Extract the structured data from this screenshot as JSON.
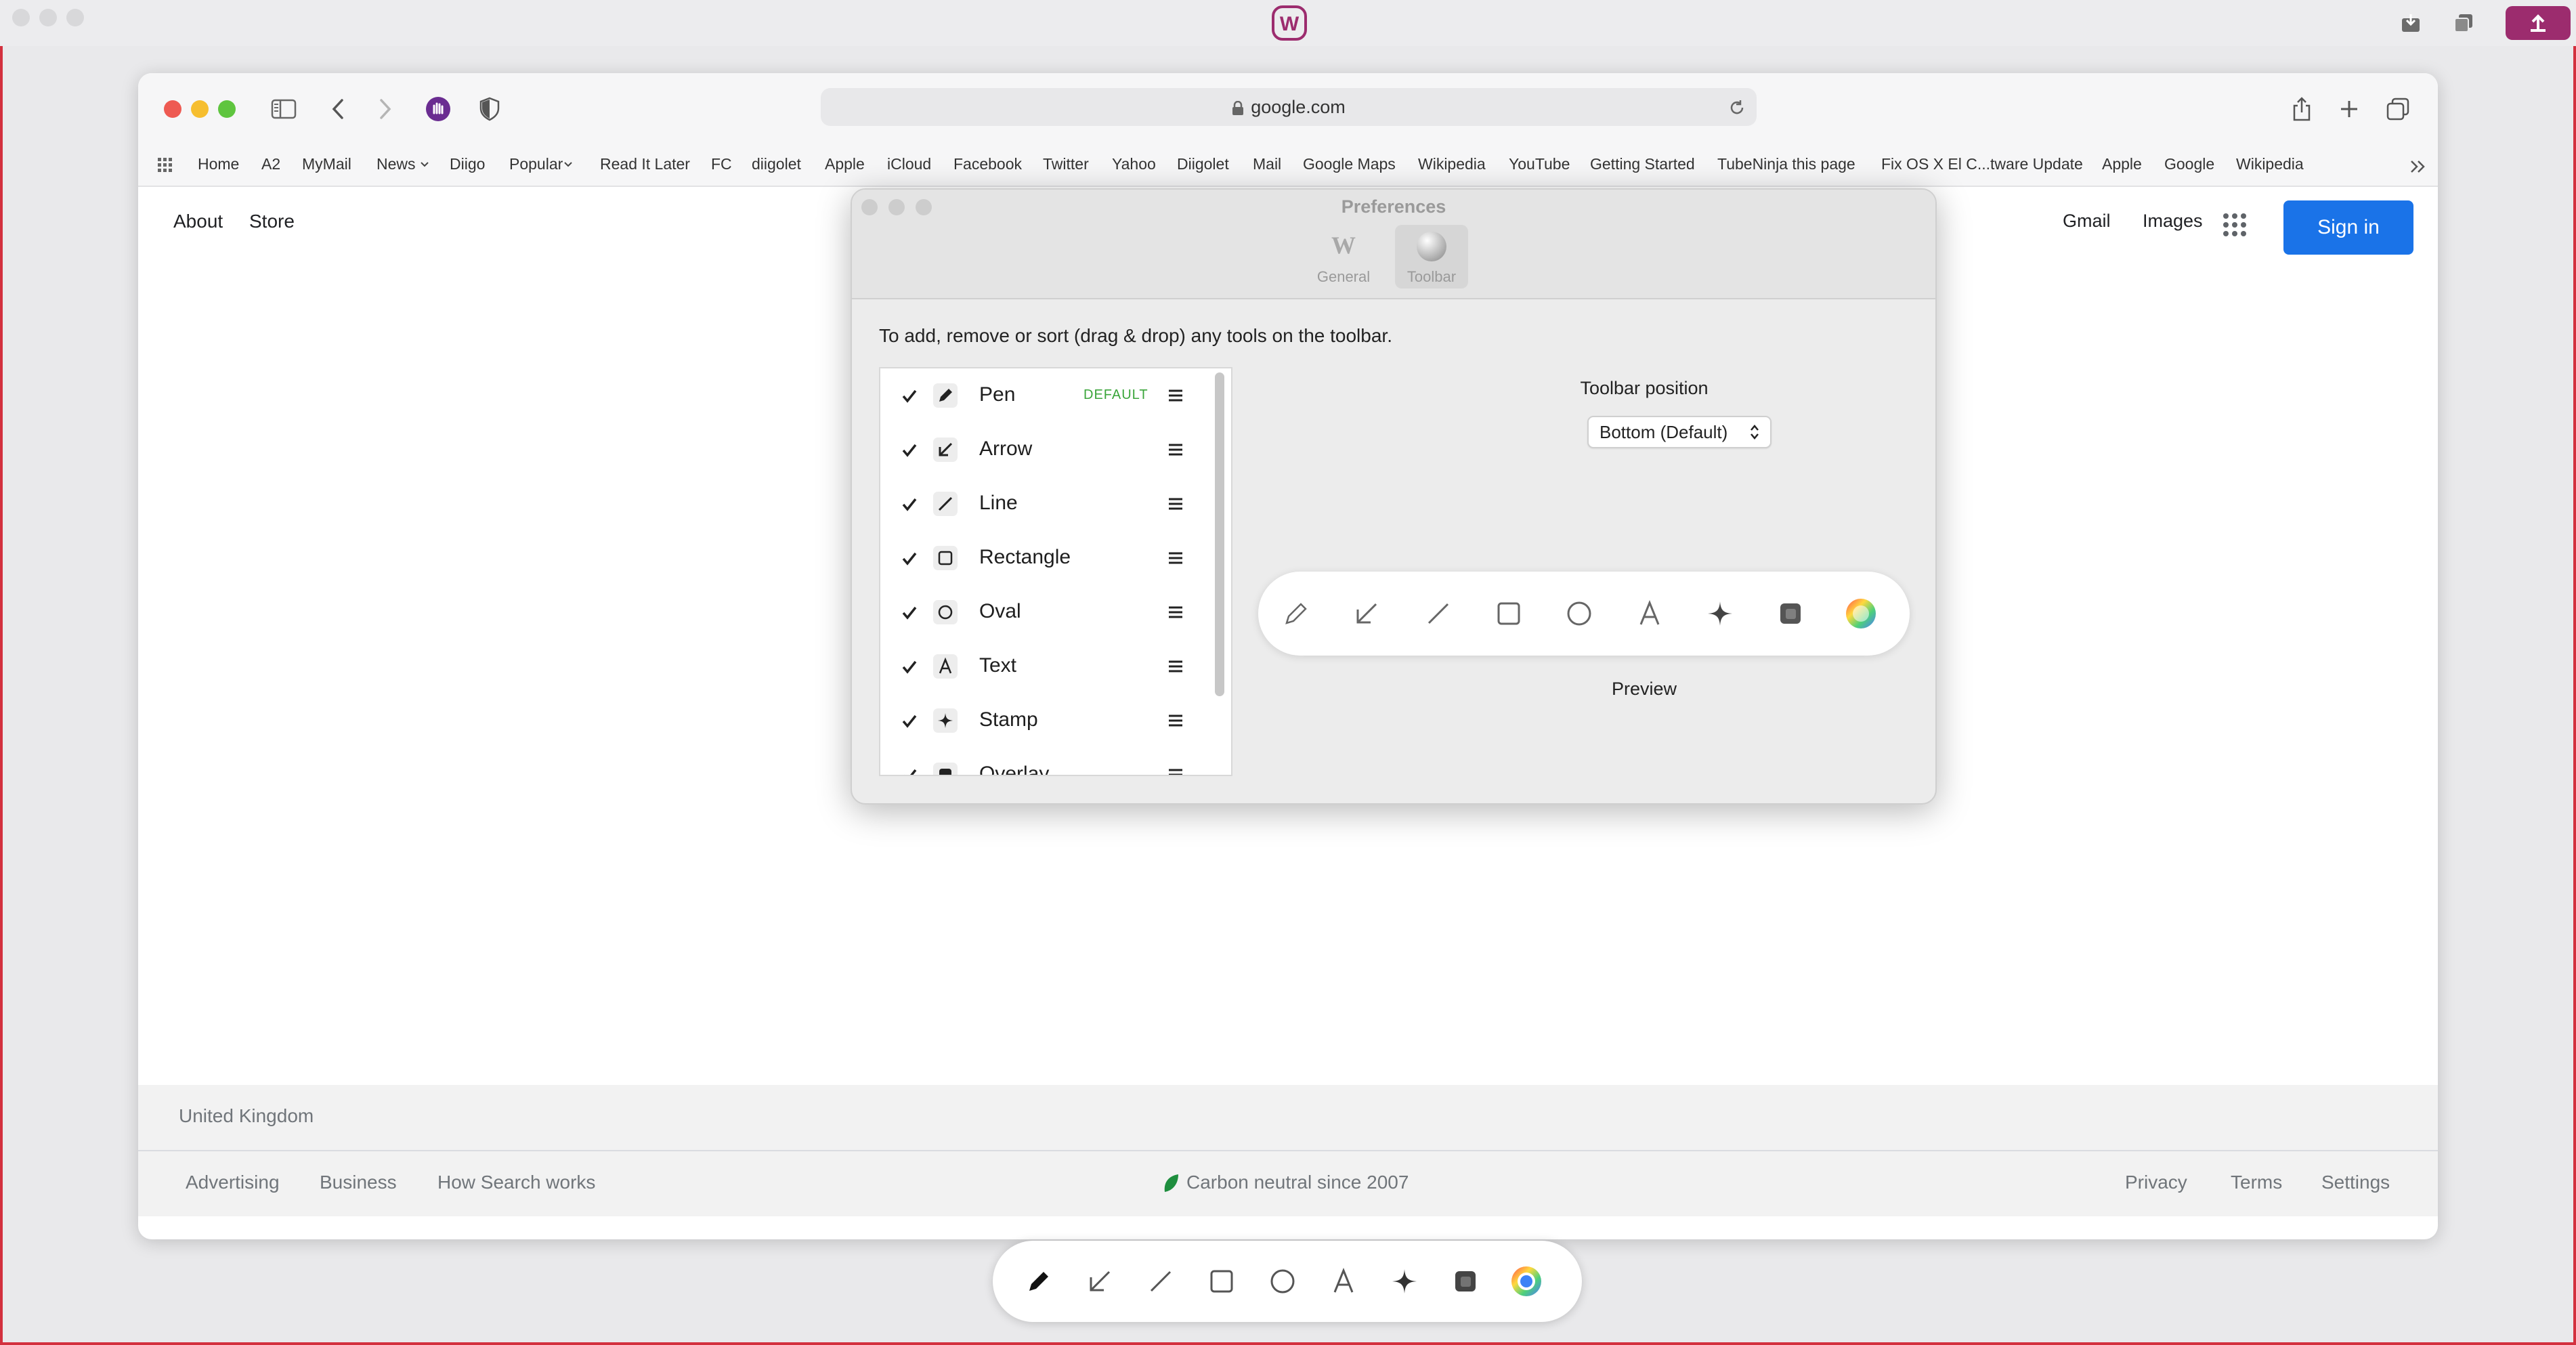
{
  "app": {
    "logo_letter": "W",
    "colors": {
      "accent": "#9c2c6e",
      "frame": "#d3303e"
    }
  },
  "browser": {
    "url": "google.com",
    "bookmarks": [
      "Home",
      "A2",
      "MyMail",
      "News",
      "Diigo",
      "Popular",
      "Read It Later",
      "FC",
      "diigolet",
      "Apple",
      "iCloud",
      "Facebook",
      "Twitter",
      "Yahoo",
      "Diigolet",
      "Mail",
      "Google Maps",
      "Wikipedia",
      "YouTube",
      "Getting Started",
      "TubeNinja this page",
      "Fix OS X El C...tware Update",
      "Apple",
      "Google",
      "Wikipedia"
    ]
  },
  "google": {
    "about": "About",
    "store": "Store",
    "gmail": "Gmail",
    "images": "Images",
    "sign_in": "Sign in",
    "country": "United Kingdom",
    "footer_left": [
      "Advertising",
      "Business",
      "How Search works"
    ],
    "carbon": "Carbon neutral since 2007",
    "footer_right": [
      "Privacy",
      "Terms",
      "Settings"
    ],
    "colors": {
      "sign_in_bg": "#1a73e8"
    }
  },
  "prefs": {
    "title": "Preferences",
    "tabs": [
      {
        "label": "General",
        "icon": "w-logo-icon",
        "selected": false
      },
      {
        "label": "Toolbar",
        "icon": "sphere-icon",
        "selected": true
      }
    ],
    "instructions": "To add, remove or sort (drag & drop) any tools on the toolbar.",
    "tools": [
      {
        "name": "Pen",
        "icon": "pen-icon",
        "checked": true,
        "badge": "DEFAULT"
      },
      {
        "name": "Arrow",
        "icon": "arrow-icon",
        "checked": true,
        "badge": ""
      },
      {
        "name": "Line",
        "icon": "line-icon",
        "checked": true,
        "badge": ""
      },
      {
        "name": "Rectangle",
        "icon": "rectangle-icon",
        "checked": true,
        "badge": ""
      },
      {
        "name": "Oval",
        "icon": "oval-icon",
        "checked": true,
        "badge": ""
      },
      {
        "name": "Text",
        "icon": "text-icon",
        "checked": true,
        "badge": ""
      },
      {
        "name": "Stamp",
        "icon": "stamp-icon",
        "checked": true,
        "badge": ""
      },
      {
        "name": "Overlay",
        "icon": "overlay-icon",
        "checked": true,
        "badge": ""
      }
    ],
    "position_label": "Toolbar position",
    "position_value": "Bottom (Default)",
    "preview_label": "Preview",
    "preview_tools": [
      "pen-icon",
      "arrow-icon",
      "line-icon",
      "rectangle-icon",
      "oval-icon",
      "text-icon",
      "stamp-icon",
      "overlay-icon",
      "color-wheel-icon"
    ]
  },
  "floating_toolbar": {
    "tools": [
      "pen-icon",
      "arrow-icon",
      "line-icon",
      "rectangle-icon",
      "oval-icon",
      "text-icon",
      "stamp-icon",
      "overlay-icon",
      "color-picker-icon"
    ]
  }
}
